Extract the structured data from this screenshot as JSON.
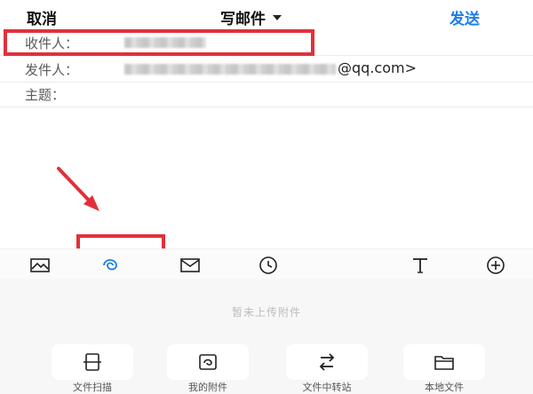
{
  "header": {
    "cancel_label": "取消",
    "title": "写邮件",
    "send_label": "发送",
    "send_color": "#1a7ee6"
  },
  "fields": {
    "recipient_label": "收件人：",
    "sender_label": "发件人：",
    "sender_email_suffix": "@qq.com>",
    "subject_label": "主题："
  },
  "toolbar": {
    "icons": [
      "image-icon",
      "attachment-icon",
      "mail-card-icon",
      "clock-icon",
      "text-format-icon",
      "add-icon"
    ]
  },
  "attachments": {
    "empty_text": "暂未上传附件",
    "actions": [
      {
        "label": "文件扫描",
        "icon": "scan-file-icon"
      },
      {
        "label": "我的附件",
        "icon": "my-attachment-icon"
      },
      {
        "label": "文件中转站",
        "icon": "transfer-station-icon"
      },
      {
        "label": "本地文件",
        "icon": "folder-icon"
      }
    ]
  },
  "annotation_color": "#e2303a"
}
